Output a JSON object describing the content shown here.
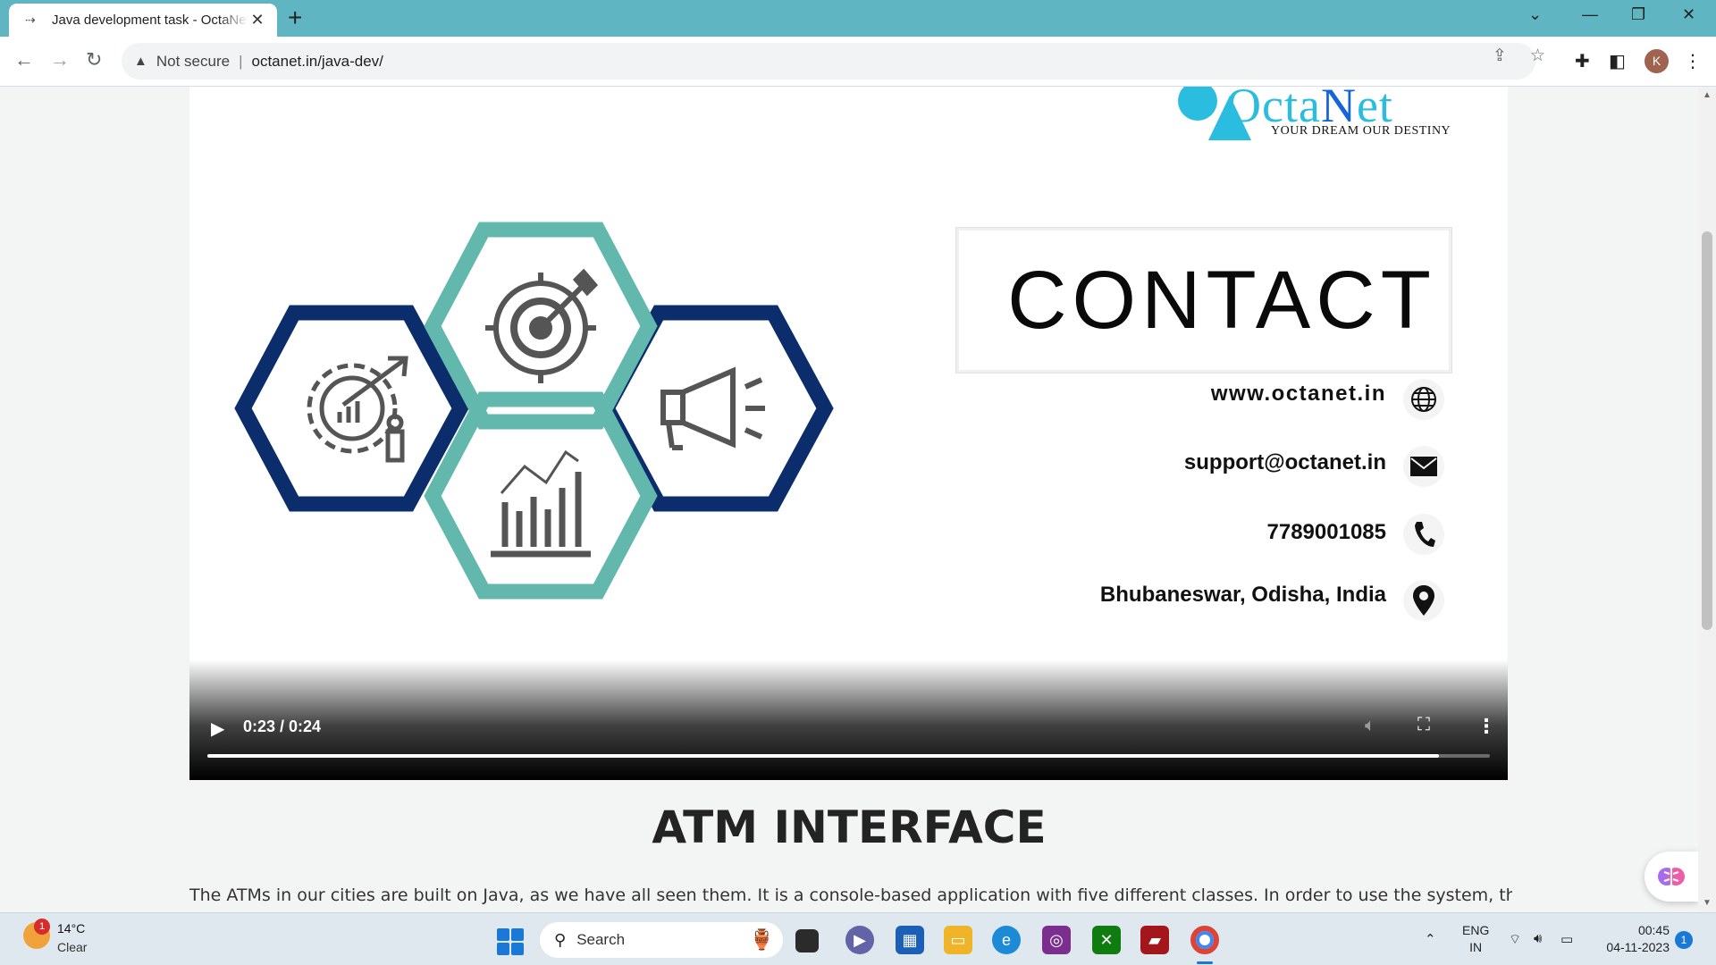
{
  "browser": {
    "tab_title": "Java development task - OctaNet",
    "address": {
      "security_label": "Not secure",
      "url": "octanet.in/java-dev/"
    },
    "profile_initial": "K"
  },
  "video": {
    "logo": {
      "word": "OctaNet",
      "word_part1": "Octa",
      "word_part2": "N",
      "word_part3": "et",
      "tagline": "YOUR DREAM OUR DESTINY"
    },
    "contact_title": "CONTACT",
    "contacts": {
      "website": "www.octanet.in",
      "email": "support@octanet.in",
      "phone": "7789001085",
      "location": "Bhubaneswar, Odisha, India"
    },
    "controls": {
      "time": "0:23 / 0:24",
      "progress": 0.96
    }
  },
  "article": {
    "heading": "ATM INTERFACE",
    "body": "The ATMs in our cities are built on Java, as we have all seen them. It is a console-based application with five different classes. In order to use the system, the user must"
  },
  "taskbar": {
    "weather": {
      "badge": "1",
      "temp": "14°C",
      "condition": "Clear"
    },
    "search_label": "Search",
    "language": {
      "line1": "ENG",
      "line2": "IN"
    },
    "clock": {
      "time": "00:45",
      "date": "04-11-2023"
    },
    "notification_count": "1"
  },
  "colors": {
    "tab_bar": "#5fb6c2",
    "hex_teal": "#62b8ad",
    "hex_navy": "#0c2d6b",
    "logo_cyan": "#2bbde0"
  }
}
